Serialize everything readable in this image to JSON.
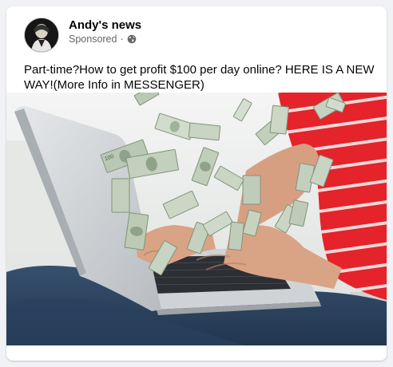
{
  "post": {
    "author": "Andy's news",
    "sponsored_label": "Sponsored",
    "separator": "·",
    "privacy_icon": "globe-icon",
    "text": "Part-time?How to get profit $100 per day online? HERE IS A NEW WAY!(More Info in MESSENGER)",
    "image": {
      "depicts": "photo-laptop-with-flying-money",
      "bill_label": "100"
    }
  },
  "colors": {
    "card_bg": "#ffffff",
    "page_bg": "#f0f2f5",
    "meta_text": "#65676b",
    "shirt_red": "#e4232b",
    "money_green": "#9fb39a"
  }
}
